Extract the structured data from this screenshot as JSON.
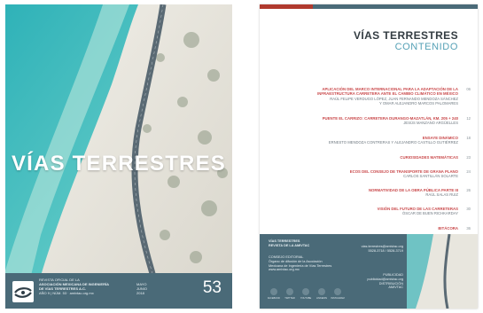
{
  "cover": {
    "title": "VÍAS TERRESTRES",
    "org_lines": [
      "REVISTA OFICIAL DE LA",
      "ASOCIACIÓN MEXICANA DE INGENIERÍA",
      "DE VÍAS TERRESTRES A.C.",
      "AÑO 9 | NÚM. 53 · amivtac.org.mx"
    ],
    "date_lines": [
      "MAYO",
      "JUNIO",
      "2018"
    ],
    "issue_number": "53"
  },
  "toc": {
    "title": "VÍAS TERRESTRES",
    "subtitle": "CONTENIDO",
    "entries": [
      {
        "title_lines": [
          "APLICACIÓN DEL MARCO INTERNACIONAL PARA LA ADAPTACIÓN DE LA",
          "INFRAESTRUCTURA CARRETERA ANTE EL CAMBIO CLIMÁTICO EN MÉXICO"
        ],
        "author_lines": [
          "RAÚL FELIPE VERDUGO LÓPEZ, JUAN FERNANDO MENDOZA SÁNCHEZ",
          "Y OMAR ALEJANDRO MARCOS PALOMARES"
        ],
        "page": "06"
      },
      {
        "title_lines": [
          "PUENTE EL CARRIZO: CARRETERA DURANGO-MAZATLÁN, KM. 205 + 240"
        ],
        "author_lines": [
          "JESÚS MANZANO ARGÜELLES"
        ],
        "page": "12"
      },
      {
        "title_lines": [
          "ENSAYE DINÁMICO"
        ],
        "author_lines": [
          "ERNESTO MENDOZA CONTRERAS Y ALEJANDRO CASTILLO GUTIÉRREZ"
        ],
        "page": "18"
      },
      {
        "title_lines": [
          "CURIOSIDADES MATEMÁTICAS"
        ],
        "author_lines": [],
        "page": "23"
      },
      {
        "title_lines": [
          "ECOS DEL CONSEJO DE TRANSPORTE DE GRANA PLANO"
        ],
        "author_lines": [
          "CARLOS SANTILLÁN SOLARTE"
        ],
        "page": "24"
      },
      {
        "title_lines": [
          "NORMATIVIDAD DE LA OBRA PÚBLICA PARTE III"
        ],
        "author_lines": [
          "RAÚL SALAS RUIZ"
        ],
        "page": "26"
      },
      {
        "title_lines": [
          "VISIÓN DEL FUTURO DE LAS CARRETERAS"
        ],
        "author_lines": [
          "ÓSCAR DE BUEN RICHKARDAY"
        ],
        "page": "30"
      },
      {
        "title_lines": [
          "BITÁCORA"
        ],
        "author_lines": [],
        "page": "36"
      }
    ],
    "footer": {
      "brand_lines": [
        "VÍAS TERRESTRES",
        "REVISTA DE LA AMIVTAC"
      ],
      "info_lines": [
        "CONSEJO EDITORIAL",
        "Órgano de difusión de la Asociación",
        "Mexicana de Ingeniería de Vías Terrestres",
        "www.amivtac.org.mx"
      ],
      "social_labels": [
        "FACEBOOK",
        "TWITTER",
        "YOUTUBE",
        "LINKEDIN",
        "INSTAGRAM"
      ],
      "contact_lines": [
        "vias.terrestres@amivtac.org",
        "5528-3718 / 5528-3719"
      ],
      "right_lines": [
        "PUBLICIDAD",
        "publicidad@amivtac.org",
        "DISTRIBUCIÓN",
        "AMIVTAC"
      ]
    }
  },
  "colors": {
    "accent_red": "#c9484a",
    "accent_blue": "#55a1b6",
    "footer": "#4a6a78"
  }
}
